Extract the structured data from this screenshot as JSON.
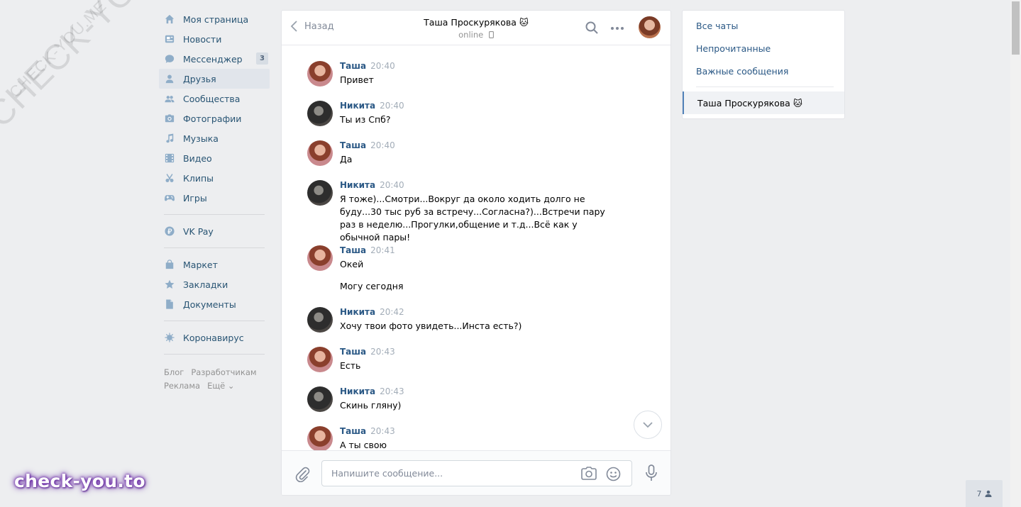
{
  "watermark": {
    "text": "CHECK-YOU.ME",
    "brand": "check-you.to"
  },
  "nav": {
    "items": [
      {
        "label": "Моя страница",
        "icon": "home-icon"
      },
      {
        "label": "Новости",
        "icon": "news-icon"
      },
      {
        "label": "Мессенджер",
        "icon": "messenger-icon",
        "badge": "3"
      },
      {
        "label": "Друзья",
        "icon": "friends-icon",
        "active": true
      },
      {
        "label": "Сообщества",
        "icon": "groups-icon"
      },
      {
        "label": "Фотографии",
        "icon": "camera-icon"
      },
      {
        "label": "Музыка",
        "icon": "music-icon"
      },
      {
        "label": "Видео",
        "icon": "video-icon"
      },
      {
        "label": "Клипы",
        "icon": "clips-icon"
      },
      {
        "label": "Игры",
        "icon": "gamepad-icon"
      }
    ],
    "vkpay": "VK Pay",
    "extra": [
      {
        "label": "Маркет",
        "icon": "market-icon"
      },
      {
        "label": "Закладки",
        "icon": "star-icon"
      },
      {
        "label": "Документы",
        "icon": "document-icon"
      }
    ],
    "covid": "Коронавирус",
    "footer": [
      "Блог",
      "Разработчикам",
      "Реклама",
      "Ещё ⌄"
    ]
  },
  "chat": {
    "back_label": "Назад",
    "peer_name": "Таша Проскурякова 🐱",
    "peer_status": "online",
    "messages": [
      {
        "author": "Таша",
        "time": "20:40",
        "text": "Привет"
      },
      {
        "author": "Никита",
        "time": "20:40",
        "text": "Ты из Спб?"
      },
      {
        "author": "Таша",
        "time": "20:40",
        "text": "Да"
      },
      {
        "author": "Никита",
        "time": "20:40",
        "text": "Я тоже)...Смотри...Вокруг да около ходить долго не буду...30 тыс руб за встречу...Согласна?)...Встречи пару раз в неделю...Прогулки,общение и т.д...Всё как у обычной пары!"
      },
      {
        "author": "Таша",
        "time": "20:41",
        "text": "Окей",
        "text2": "Могу сегодня"
      },
      {
        "author": "Никита",
        "time": "20:42",
        "text": "Хочу твои фото увидеть...Инста есть?)"
      },
      {
        "author": "Таша",
        "time": "20:43",
        "text": "Есть"
      },
      {
        "author": "Никита",
        "time": "20:43",
        "text": "Скинь гляну)"
      },
      {
        "author": "Таша",
        "time": "20:43",
        "text": "А ты свою"
      }
    ],
    "composer_placeholder": "Напишите сообщение..."
  },
  "side": {
    "filters": [
      "Все чаты",
      "Непрочитанные",
      "Важные сообщения"
    ],
    "active_chat": "Таша Проскурякова 🐱"
  },
  "online_count": "7",
  "colors": {
    "link": "#2a5885",
    "accent": "#5181b8",
    "bg": "#edeef0"
  }
}
